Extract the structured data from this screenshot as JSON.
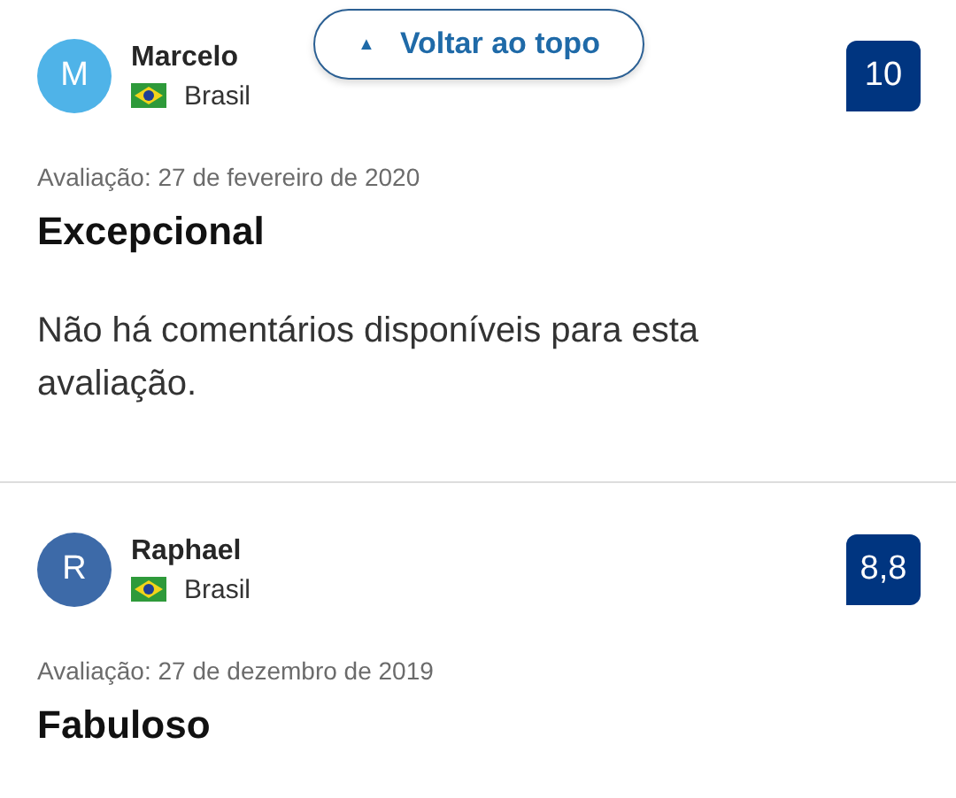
{
  "back_to_top": {
    "icon": "▲",
    "label": "Voltar ao topo"
  },
  "reviews": [
    {
      "initial": "M",
      "color": "#4fb3e8",
      "name": "Marcelo",
      "country": "Brasil",
      "score": "10",
      "date": "Avaliação: 27 de fevereiro de 2020",
      "title": "Excepcional",
      "comment": "Não há comentários disponíveis para esta avaliação."
    },
    {
      "initial": "R",
      "color": "#3d6aa8",
      "name": "Raphael",
      "country": "Brasil",
      "score": "8,8",
      "date": "Avaliação: 27 de dezembro de 2019",
      "title": "Fabuloso"
    }
  ]
}
